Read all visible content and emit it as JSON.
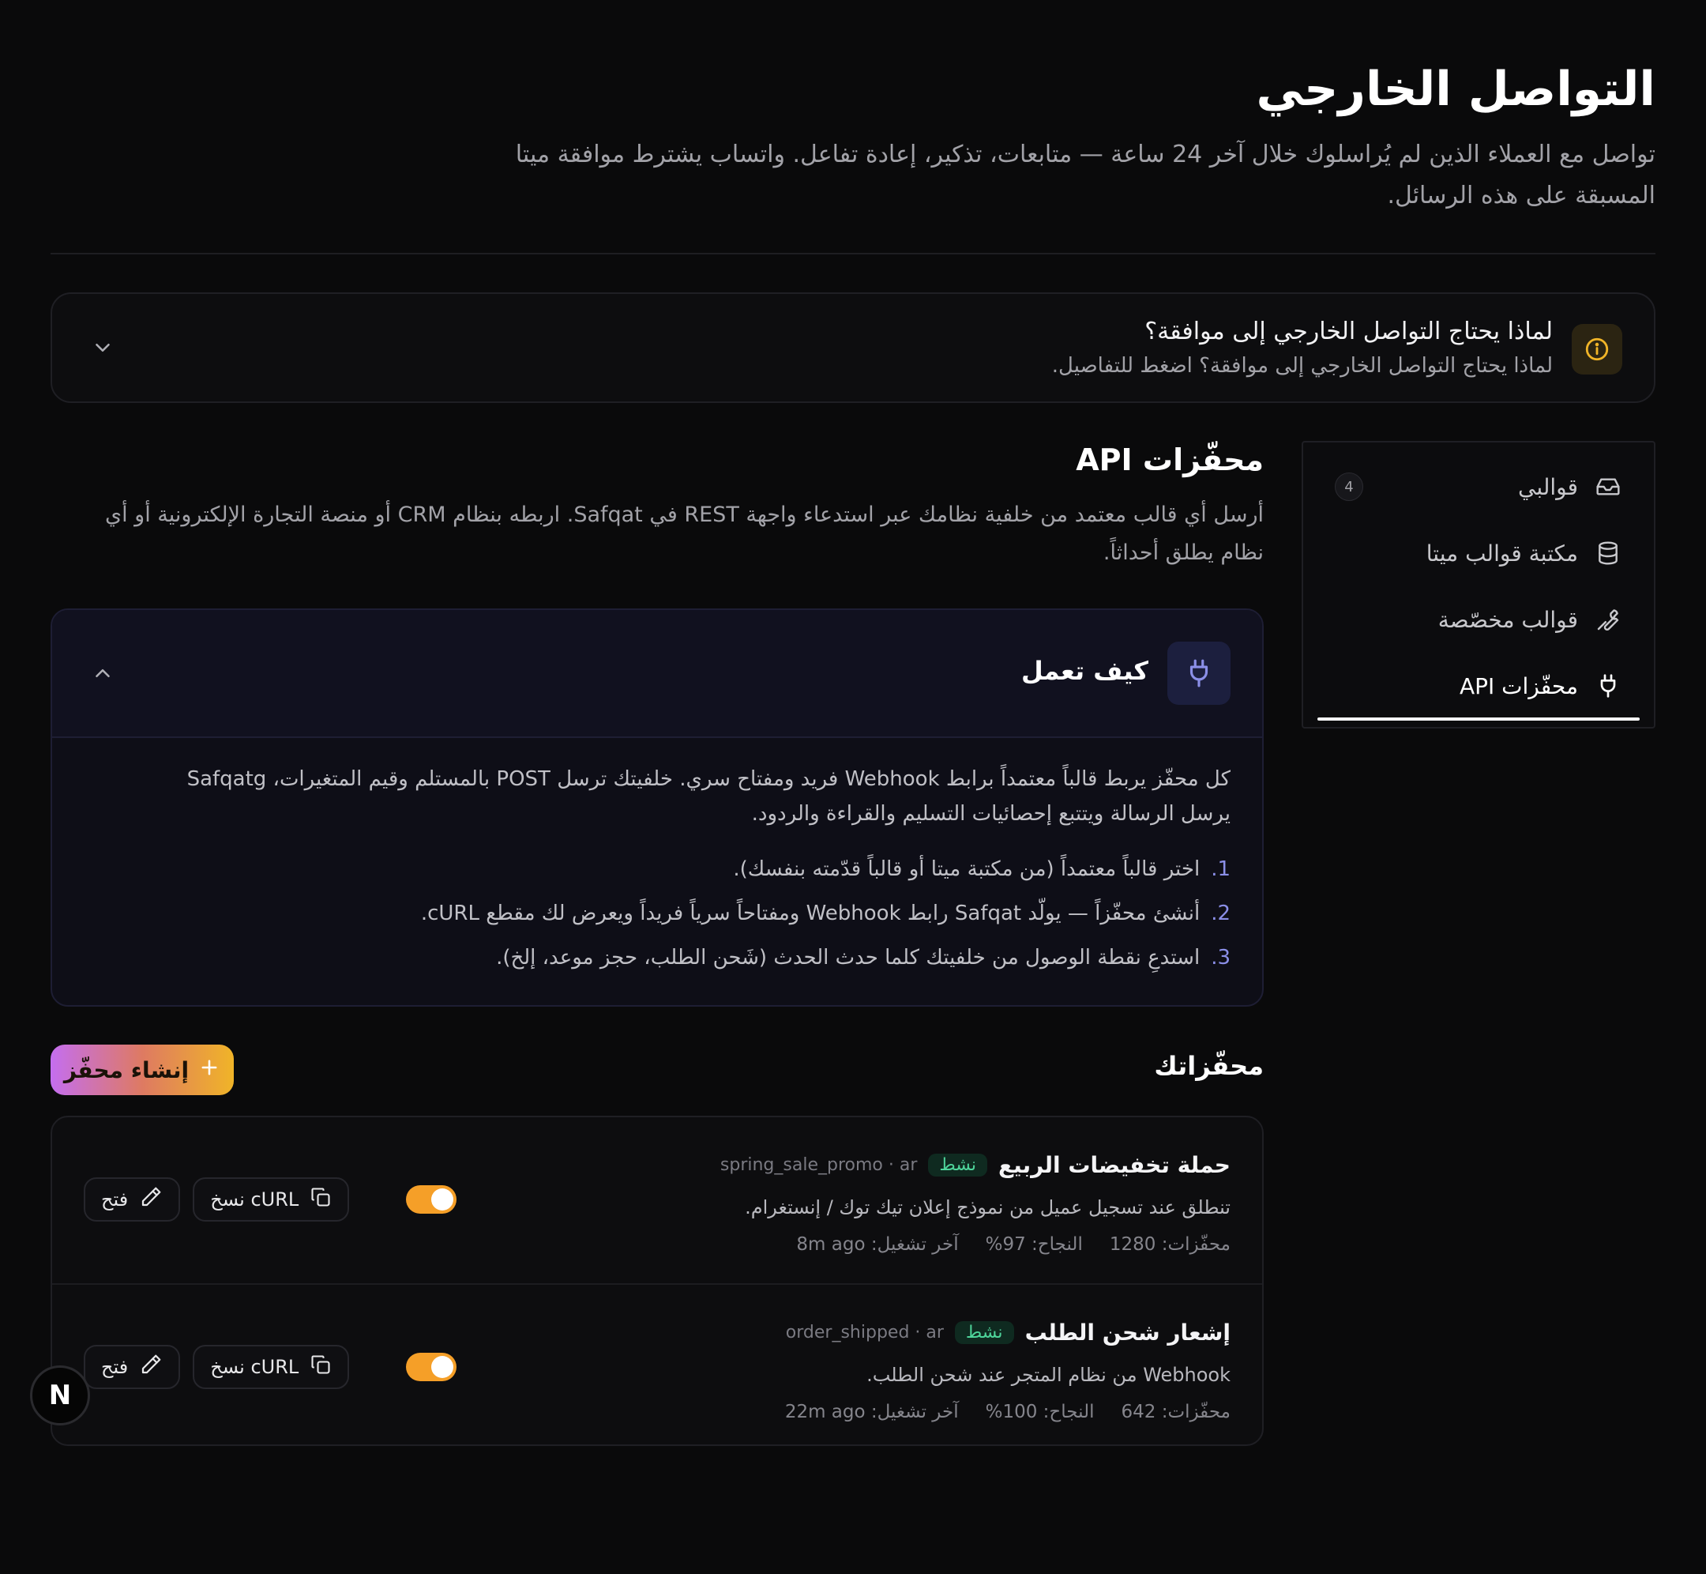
{
  "header": {
    "title": "التواصل الخارجي",
    "subtitle": "تواصل مع العملاء الذين لم يُراسلوك خلال آخر 24 ساعة — متابعات، تذكير، إعادة تفاعل. واتساب يشترط موافقة ميتا المسبقة على هذه الرسائل."
  },
  "info": {
    "title": "لماذا يحتاج التواصل الخارجي إلى موافقة؟",
    "description": "لماذا يحتاج التواصل الخارجي إلى موافقة؟ اضغط للتفاصيل."
  },
  "sidenav": {
    "items": [
      {
        "label": "قوالبي",
        "icon": "inbox-icon",
        "count": "4"
      },
      {
        "label": "مكتبة قوالب ميتا",
        "icon": "database-icon"
      },
      {
        "label": "قوالب مخصّصة",
        "icon": "wrench-icon"
      },
      {
        "label": "محفّزات API",
        "icon": "plug-icon",
        "active": true
      }
    ]
  },
  "main": {
    "title": "محفّزات API",
    "description": "أرسل أي قالب معتمد من خلفية نظامك عبر استدعاء واجهة REST في Safqat. اربطه بنظام CRM أو منصة التجارة الإلكترونية أو أي نظام يطلق أحداثاً.",
    "how": {
      "title": "كيف تعمل",
      "intro": "كل محفّز يربط قالباً معتمداً برابط Webhook فريد ومفتاح سري. خلفيتك ترسل POST بالمستلم وقيم المتغيرات، Safqatg يرسل الرسالة ويتتبع إحصائيات التسليم والقراءة والردود.",
      "steps": [
        {
          "num": "1.",
          "text": "اختر قالباً معتمداً (من مكتبة ميتا أو قالباً قدّمته بنفسك)."
        },
        {
          "num": "2.",
          "text": "أنشئ محفّزاً — يولّد Safqat رابط Webhook ومفتاحاً سرياً فريداً ويعرض لك مقطع cURL."
        },
        {
          "num": "3.",
          "text": "استدعِ نقطة الوصول من خلفيتك كلما حدث الحدث (شَحن الطلب، حجز موعد، إلخ)."
        }
      ]
    },
    "triggers_title": "محفّزاتك",
    "create_label": "إنشاء محفّز",
    "triggers": [
      {
        "name": "حملة تخفيضات الربيع",
        "status": "نشط",
        "key": "spring_sale_promo · ar",
        "description": "تنطلق عند تسجيل عميل من نموذج إعلان تيك توك / إنستغرام.",
        "stats": [
          "محفّزات: 1280",
          "النجاح: 97%",
          "آخر تشغيل: 8m ago"
        ],
        "enabled": true
      },
      {
        "name": "إشعار شحن الطلب",
        "status": "نشط",
        "key": "order_shipped · ar",
        "description": "Webhook من نظام المتجر عند شحن الطلب.",
        "stats": [
          "محفّزات: 642",
          "النجاح: 100%",
          "آخر تشغيل: 22m ago"
        ],
        "enabled": true
      }
    ],
    "actions": {
      "copy_label": "نسخ cURL",
      "open_label": "فتح"
    }
  },
  "fab": {
    "label": "N"
  },
  "colors": {
    "accent": "#f59f28",
    "success": "#4ed49a",
    "indigo": "#8b8fe8",
    "warning": "#f0b428"
  }
}
